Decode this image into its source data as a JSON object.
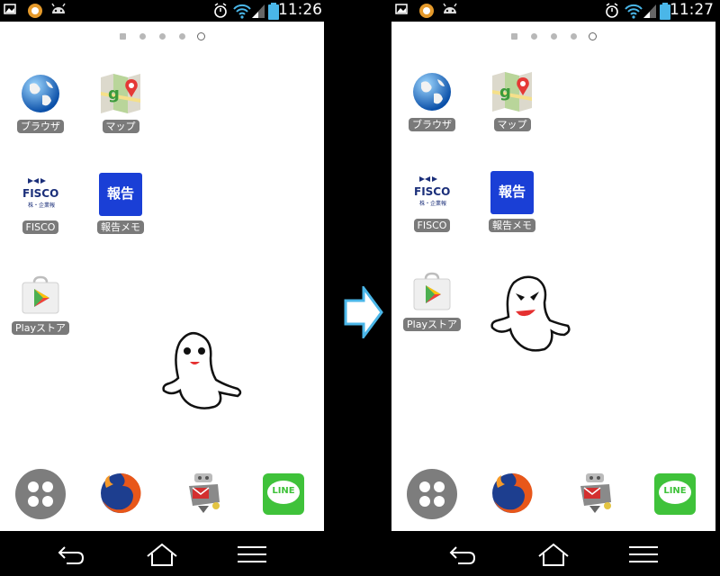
{
  "left": {
    "status_time": "11:26",
    "apps": {
      "browser": "ブラウザ",
      "maps": "マップ",
      "fisco": "FISCO",
      "memo": "報告メモ",
      "play": "Playストア"
    },
    "fisco_logo": "FISCO",
    "fisco_sub": "株・企業報",
    "memo_icon_text": "報告",
    "line_icon_text": "LINE"
  },
  "right": {
    "status_time": "11:27",
    "apps": {
      "browser": "ブラウザ",
      "maps": "マップ",
      "fisco": "FISCO",
      "memo": "報告メモ",
      "play": "Playストア"
    },
    "fisco_logo": "FISCO",
    "fisco_sub": "株・企業報",
    "memo_icon_text": "報告",
    "line_icon_text": "LINE"
  },
  "colors": {
    "label_bg": "#7a7a7a",
    "memo_blue": "#1a3fd6",
    "line_green": "#3fc23a",
    "background": "#ffffff"
  }
}
